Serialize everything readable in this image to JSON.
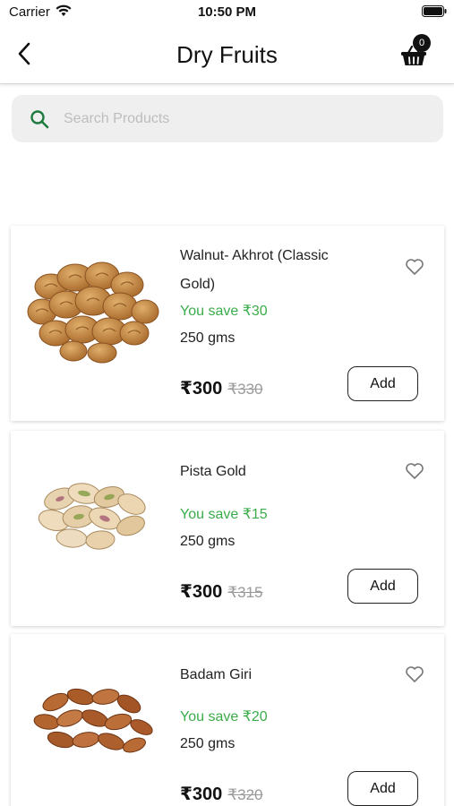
{
  "status_bar": {
    "carrier": "Carrier",
    "time": "10:50 PM"
  },
  "nav": {
    "title": "Dry Fruits",
    "cart_count": "0"
  },
  "search": {
    "placeholder": "Search Products",
    "value": ""
  },
  "colors": {
    "accent_green": "#3aac4a",
    "search_icon": "#1f7a3f"
  },
  "products": [
    {
      "name": "Walnut- Akhrot (Classic Gold)",
      "save": "You save ₹30",
      "weight": "250 gms",
      "price": "₹300",
      "original_price": "₹330",
      "add_label": "Add",
      "image_icon": "walnut-image"
    },
    {
      "name": "Pista Gold",
      "save": "You save ₹15",
      "weight": "250 gms",
      "price": "₹300",
      "original_price": "₹315",
      "add_label": "Add",
      "image_icon": "pistachio-image"
    },
    {
      "name": "Badam  Giri",
      "save": "You save ₹20",
      "weight": "250 gms",
      "price": "₹300",
      "original_price": "₹320",
      "add_label": "Add",
      "image_icon": "almond-image"
    }
  ]
}
